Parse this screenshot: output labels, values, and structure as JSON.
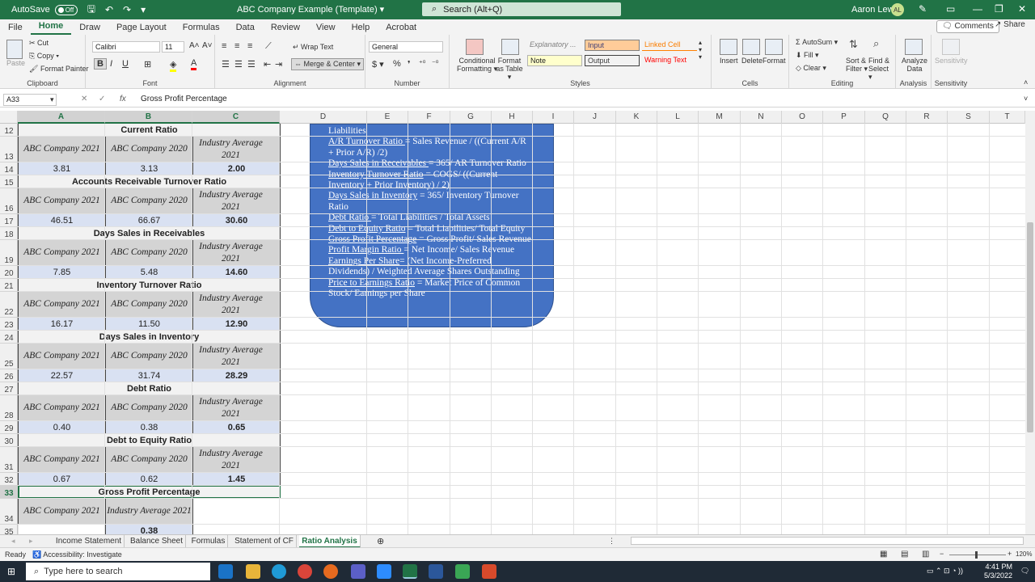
{
  "titlebar": {
    "autosave": "AutoSave",
    "autosave_state": "Off",
    "doc_title": "ABC Company Example (Template) ▾",
    "search_placeholder": "Search (Alt+Q)",
    "user": "Aaron Lewis",
    "initials": "AL"
  },
  "menu": [
    "File",
    "Home",
    "Draw",
    "Page Layout",
    "Formulas",
    "Data",
    "Review",
    "View",
    "Help",
    "Acrobat"
  ],
  "menu_active": "Home",
  "comments": "Comments",
  "share": "Share",
  "ribbon": {
    "clipboard": {
      "label": "Clipboard",
      "paste": "Paste",
      "cut": "Cut",
      "copy": "Copy ▾",
      "format_painter": "Format Painter"
    },
    "font": {
      "label": "Font",
      "name": "Calibri",
      "size": "11"
    },
    "alignment": {
      "label": "Alignment",
      "wrap": "Wrap Text",
      "merge": "Merge & Center ▾"
    },
    "number": {
      "label": "Number",
      "format": "General"
    },
    "styles": {
      "label": "Styles",
      "conditional": "Conditional Formatting ▾",
      "format_table": "Format as Table ▾",
      "cells": [
        {
          "text": "Explanatory ...",
          "style": "explanatory"
        },
        {
          "text": "Input",
          "style": "input"
        },
        {
          "text": "Linked Cell",
          "style": "linked"
        },
        {
          "text": "Note",
          "style": "note"
        },
        {
          "text": "Output",
          "style": "output"
        },
        {
          "text": "Warning Text",
          "style": "warning"
        }
      ]
    },
    "cells": {
      "label": "Cells",
      "insert": "Insert",
      "delete": "Delete",
      "format": "Format"
    },
    "editing": {
      "label": "Editing",
      "autosum": "AutoSum ▾",
      "fill": "Fill ▾",
      "clear": "Clear ▾",
      "sort": "Sort & Filter ▾",
      "find": "Find & Select ▾"
    },
    "analysis": {
      "label": "Analysis",
      "analyze": "Analyze Data"
    },
    "sensitivity": {
      "label": "Sensitivity",
      "btn": "Sensitivity"
    }
  },
  "formula_bar": {
    "name_box": "A33",
    "fx": "fx",
    "content": "Gross Profit Percentage"
  },
  "columns": [
    "A",
    "B",
    "C",
    "D",
    "E",
    "F",
    "G",
    "H",
    "I",
    "J",
    "K",
    "L",
    "M",
    "N",
    "O",
    "P",
    "Q",
    "R",
    "S",
    "T"
  ],
  "rows": [
    "12",
    "13",
    "14",
    "15",
    "16",
    "17",
    "18",
    "19",
    "20",
    "21",
    "22",
    "23",
    "24",
    "25",
    "26",
    "27",
    "28",
    "29",
    "30",
    "31",
    "32",
    "33",
    "34",
    "35"
  ],
  "headers": {
    "a": "ABC Company 2021",
    "b": "ABC Company 2020",
    "c": "Industry Average 2021"
  },
  "blocks": [
    {
      "title": "Current Ratio",
      "a": "3.81",
      "b": "3.13",
      "c": "2.00"
    },
    {
      "title": "Accounts Receivable Turnover Ratio",
      "a": "46.51",
      "b": "66.67",
      "c": "30.60"
    },
    {
      "title": "Days Sales in Receivables",
      "a": "7.85",
      "b": "5.48",
      "c": "14.60"
    },
    {
      "title": "Inventory Turnover Ratio",
      "a": "16.17",
      "b": "11.50",
      "c": "12.90"
    },
    {
      "title": "Days Sales in Inventory",
      "a": "22.57",
      "b": "31.74",
      "c": "28.29"
    },
    {
      "title": "Debt Ratio",
      "a": "0.40",
      "b": "0.38",
      "c": "0.65"
    },
    {
      "title": "Debt to Equity Ratio",
      "a": "0.67",
      "b": "0.62",
      "c": "1.45"
    }
  ],
  "last_block": {
    "title": "Gross Profit Percentage",
    "a": "ABC Company 2021",
    "b": "Industry Average 2021",
    "b_value": "0.38"
  },
  "infobox": [
    [
      {
        "t": "Liabilities",
        "u": false
      }
    ],
    [
      {
        "t": "A/R Turnover Ratio ",
        "u": true
      },
      {
        "t": "= Sales Revenue / ((Current A/R",
        "u": false
      }
    ],
    [
      {
        "t": "+ Prior A/R) /2)",
        "u": false
      }
    ],
    [
      {
        "t": "Days Sales in Receivables ",
        "u": true
      },
      {
        "t": "= 365/ AR Turnover Ratio",
        "u": false
      }
    ],
    [
      {
        "t": "Inventory Turnover Ratio",
        "u": true
      },
      {
        "t": " = COGS/ ((Current",
        "u": false
      }
    ],
    [
      {
        "t": "Inventory + Prior Inventory) / 2)",
        "u": false
      }
    ],
    [
      {
        "t": "Days Sales in Inventory",
        "u": true
      },
      {
        "t": " = 365/ Inventory Turnover",
        "u": false
      }
    ],
    [
      {
        "t": "Ratio",
        "u": false
      }
    ],
    [
      {
        "t": "Debt Ratio ",
        "u": true
      },
      {
        "t": "= Total Liabilities / Total Assets",
        "u": false
      }
    ],
    [
      {
        "t": "Debt to Equity Ratio",
        "u": true
      },
      {
        "t": " = Total Liabilities/ Total Equity",
        "u": false
      }
    ],
    [
      {
        "t": "Gross Profit Percentage",
        "u": true
      },
      {
        "t": " = Gross Profit/ Sales Revenue",
        "u": false
      }
    ],
    [
      {
        "t": "Profit Margin Ratio ",
        "u": true
      },
      {
        "t": "=  Net Income/ Sales Revenue",
        "u": false
      }
    ],
    [
      {
        "t": "Earnings Per Share",
        "u": true
      },
      {
        "t": "= (Net Income-Preferred",
        "u": false
      }
    ],
    [
      {
        "t": "Dividends) / Weighted Average Shares Outstanding",
        "u": false
      }
    ],
    [
      {
        "t": "Price to Earnings Ratio",
        "u": true
      },
      {
        "t": " = Market Price of Common",
        "u": false
      }
    ],
    [
      {
        "t": "Stock/ Earnings per Share",
        "u": false
      }
    ]
  ],
  "sheets": [
    "Income Statement",
    "Balance Sheet",
    "Formulas",
    "Statement of CF",
    "Ratio Analysis"
  ],
  "active_sheet": "Ratio Analysis",
  "status": {
    "ready": "Ready",
    "accessibility": "Accessibility: Investigate",
    "zoom": "120%"
  },
  "taskbar": {
    "search": "Type here to search",
    "time": "4:41 PM",
    "date": "5/3/2022"
  },
  "colors": {
    "excel_green": "#217346",
    "header_gray": "#d4d4d4",
    "value_blue": "#d9e1f2",
    "shape_blue": "#4472c4"
  }
}
